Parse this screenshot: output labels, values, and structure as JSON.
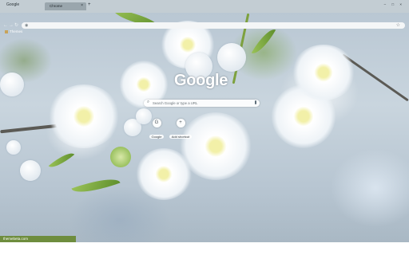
{
  "window": {
    "title": "Google",
    "controls": "– □ ×"
  },
  "tab": {
    "label": "Chrome",
    "close": "×",
    "new_tab": "+"
  },
  "toolbar": {
    "back": "←",
    "forward": "→",
    "reload": "↻",
    "omni_icon": "◉",
    "star": "☆"
  },
  "bookmarks": {
    "items": [
      {
        "label": "Themes"
      }
    ]
  },
  "ntp": {
    "logo": "Google",
    "search_placeholder": "Search Google or type a URL",
    "shortcuts": [
      {
        "label": "Google",
        "icon": "G"
      },
      {
        "label": "Add shortcut",
        "icon": "+"
      }
    ]
  },
  "status": {
    "text": "themebeta.com"
  }
}
